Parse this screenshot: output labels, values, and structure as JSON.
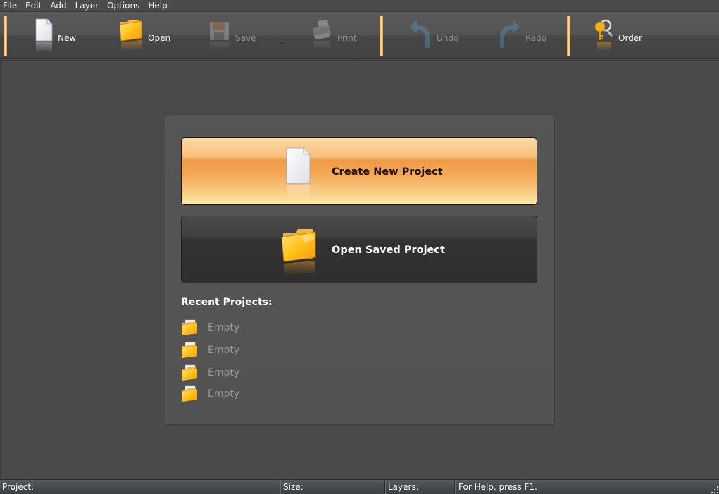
{
  "menu": [
    "File",
    "Edit",
    "Add",
    "Layer",
    "Options",
    "Help"
  ],
  "toolbar": {
    "new": {
      "label": "New",
      "icon": "document-icon",
      "enabled": true
    },
    "open": {
      "label": "Open",
      "icon": "folder-icon",
      "enabled": true
    },
    "save": {
      "label": "Save",
      "icon": "floppy-disk-icon",
      "enabled": false
    },
    "print": {
      "label": "Print",
      "icon": "printer-icon",
      "enabled": false
    },
    "undo": {
      "label": "Undo",
      "icon": "undo-arrow-icon",
      "enabled": false
    },
    "redo": {
      "label": "Redo",
      "icon": "redo-arrow-icon",
      "enabled": false
    },
    "order": {
      "label": "Order",
      "icon": "keys-icon",
      "enabled": true
    }
  },
  "start_panel": {
    "create_label": "Create New Project",
    "open_label": "Open Saved Project",
    "recent_title": "Recent Projects:",
    "recent": [
      {
        "label": "Empty"
      },
      {
        "label": "Empty"
      },
      {
        "label": "Empty"
      },
      {
        "label": "Empty"
      }
    ]
  },
  "statusbar": {
    "project": "Project:",
    "size": "Size:",
    "layers": "Layers:",
    "help": "For Help, press F1."
  },
  "colors": {
    "accent_orange": "#f09a45",
    "separator_orange": "#e59a3c",
    "background": "#4a4a4a"
  }
}
